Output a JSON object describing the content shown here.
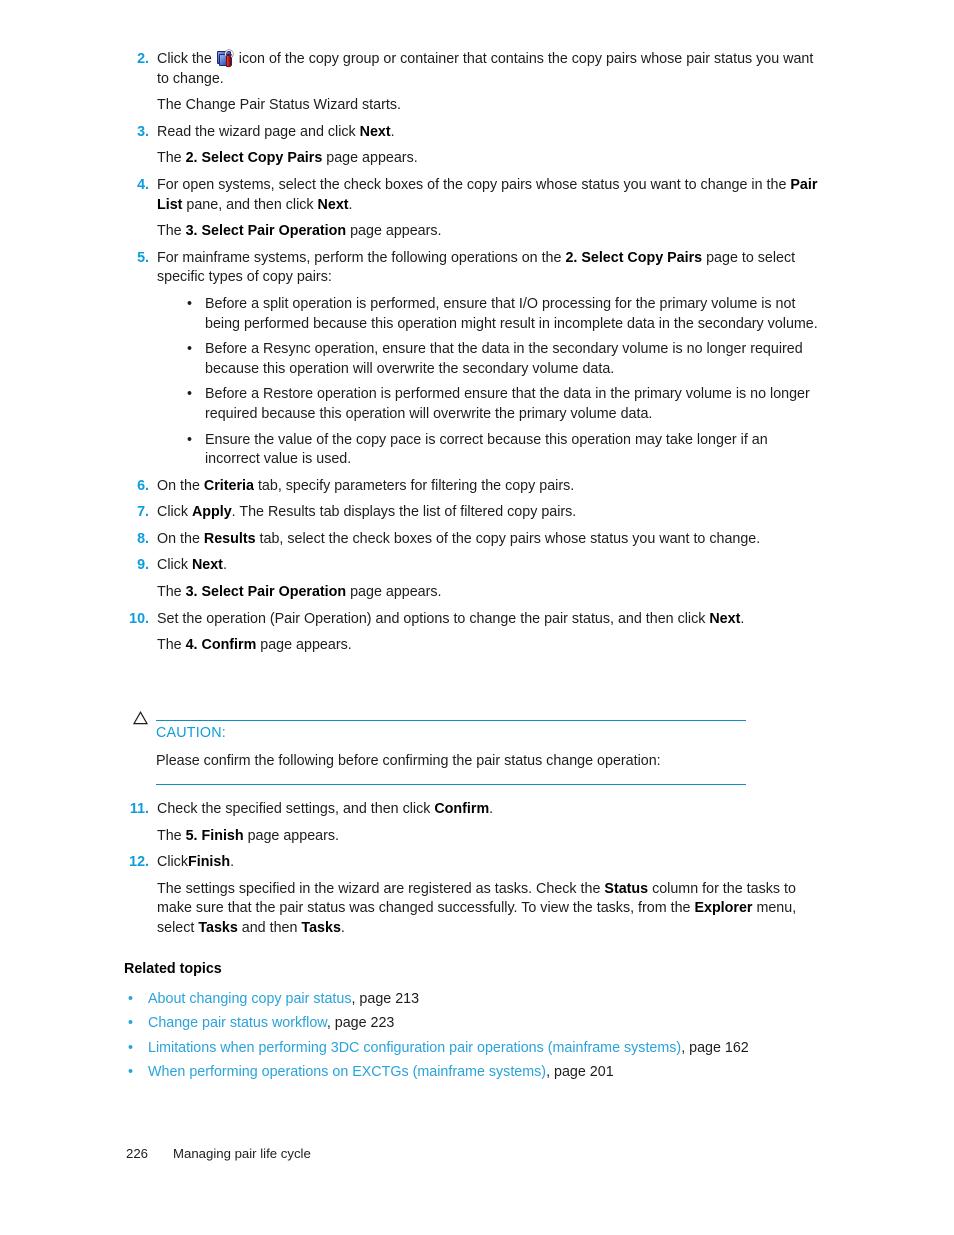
{
  "page": {
    "footer_page_number": "226",
    "footer_chapter": "Managing pair life cycle"
  },
  "steps": [
    {
      "num": "2.",
      "paras": [
        {
          "id": "s2p1_a",
          "text": "Click the "
        },
        {
          "id": "s2p1_b",
          "text": " icon of the copy group or container that contains the copy pairs whose pair status you want to change."
        },
        {
          "id": "s2p2",
          "text": "The Change Pair Status Wizard starts."
        }
      ],
      "icon_name": "copy-group-settings-icon"
    },
    {
      "num": "3.",
      "p1_pre": "Read the wizard page and click ",
      "p1_bold": "Next",
      "p1_post": ".",
      "p2_pre": "The ",
      "p2_bold": "2. Select Copy Pairs",
      "p2_post": " page appears."
    },
    {
      "num": "4.",
      "p1_a": "For open systems, select the check boxes of the copy pairs whose status you want to change in the ",
      "p1_b1": "Pair List",
      "p1_b": " pane, and then click ",
      "p1_b2": "Next",
      "p1_c": ".",
      "p2_pre": "The ",
      "p2_bold": "3. Select Pair Operation",
      "p2_post": " page appears."
    },
    {
      "num": "5.",
      "p1_a": "For mainframe systems, perform the following operations on the ",
      "p1_bold": "2. Select Copy Pairs",
      "p1_b": " page to select specific types of copy pairs:",
      "bullets": [
        "Before a split operation is performed, ensure that I/O processing for the primary volume is not being performed because this operation might result in incomplete data in the secondary volume.",
        "Before a Resync operation, ensure that the data in the secondary volume is no longer required because this operation will overwrite the secondary volume data.",
        "Before a Restore operation is performed ensure that the data in the primary volume is no longer required because this operation will overwrite the primary volume data.",
        "Ensure the value of the copy pace is correct because this operation may take longer if an incorrect value is used."
      ]
    },
    {
      "num": "6.",
      "p1_a": "On the ",
      "p1_bold": "Criteria",
      "p1_b": " tab, specify parameters for filtering the copy pairs."
    },
    {
      "num": "7.",
      "p1_a": "Click ",
      "p1_bold": "Apply",
      "p1_b": ". The Results tab displays the list of filtered copy pairs."
    },
    {
      "num": "8.",
      "p1_a": "On the ",
      "p1_bold": "Results",
      "p1_b": " tab, select the check boxes of the copy pairs whose status you want to change."
    },
    {
      "num": "9.",
      "p1_a": "Click ",
      "p1_bold": "Next",
      "p1_b": ".",
      "p2_pre": "The ",
      "p2_bold": "3. Select Pair Operation",
      "p2_post": " page appears."
    },
    {
      "num": "10.",
      "p1_a": "Set the operation (Pair Operation) and options to change the pair status, and then click ",
      "p1_bold": "Next",
      "p1_b": ".",
      "p2_pre": "The ",
      "p2_bold": "4. Confirm",
      "p2_post": " page appears."
    }
  ],
  "caution": {
    "icon_name": "warning-triangle-icon",
    "label": "CAUTION:",
    "body": "Please confirm the following before confirming the pair status change operation:"
  },
  "steps_after": [
    {
      "num": "11.",
      "p1_a": "Check the specified settings, and then click ",
      "p1_bold": "Confirm",
      "p1_b": ".",
      "p2_pre": "The ",
      "p2_bold": "5. Finish",
      "p2_post": " page appears."
    },
    {
      "num": "12.",
      "p1_a": "Click",
      "p1_bold": "Finish",
      "p1_b": ".",
      "p2_a": "The settings specified in the wizard are registered as tasks. Check the ",
      "p2_b1": "Status",
      "p2_b": " column for the tasks to make sure that the pair status was changed successfully. To view the tasks, from the ",
      "p2_b2": "Explorer",
      "p2_c": " menu, select ",
      "p2_b3": "Tasks",
      "p2_d": " and then ",
      "p2_b4": "Tasks",
      "p2_e": "."
    }
  ],
  "related": {
    "heading": "Related topics",
    "items": [
      {
        "link": "About changing copy pair status",
        "page": ", page 213"
      },
      {
        "link": "Change pair status workflow",
        "page": ", page 223"
      },
      {
        "link": "Limitations when performing 3DC configuration pair operations (mainframe systems)",
        "page": ", page 162"
      },
      {
        "link": "When performing operations on EXCTGs (mainframe systems)",
        "page": ", page 201"
      }
    ]
  },
  "colors": {
    "accent_blue": "#0d9ddb",
    "link_blue": "#29a3da",
    "rule_blue": "#0d8ec4",
    "text": "#1d1d1d"
  }
}
